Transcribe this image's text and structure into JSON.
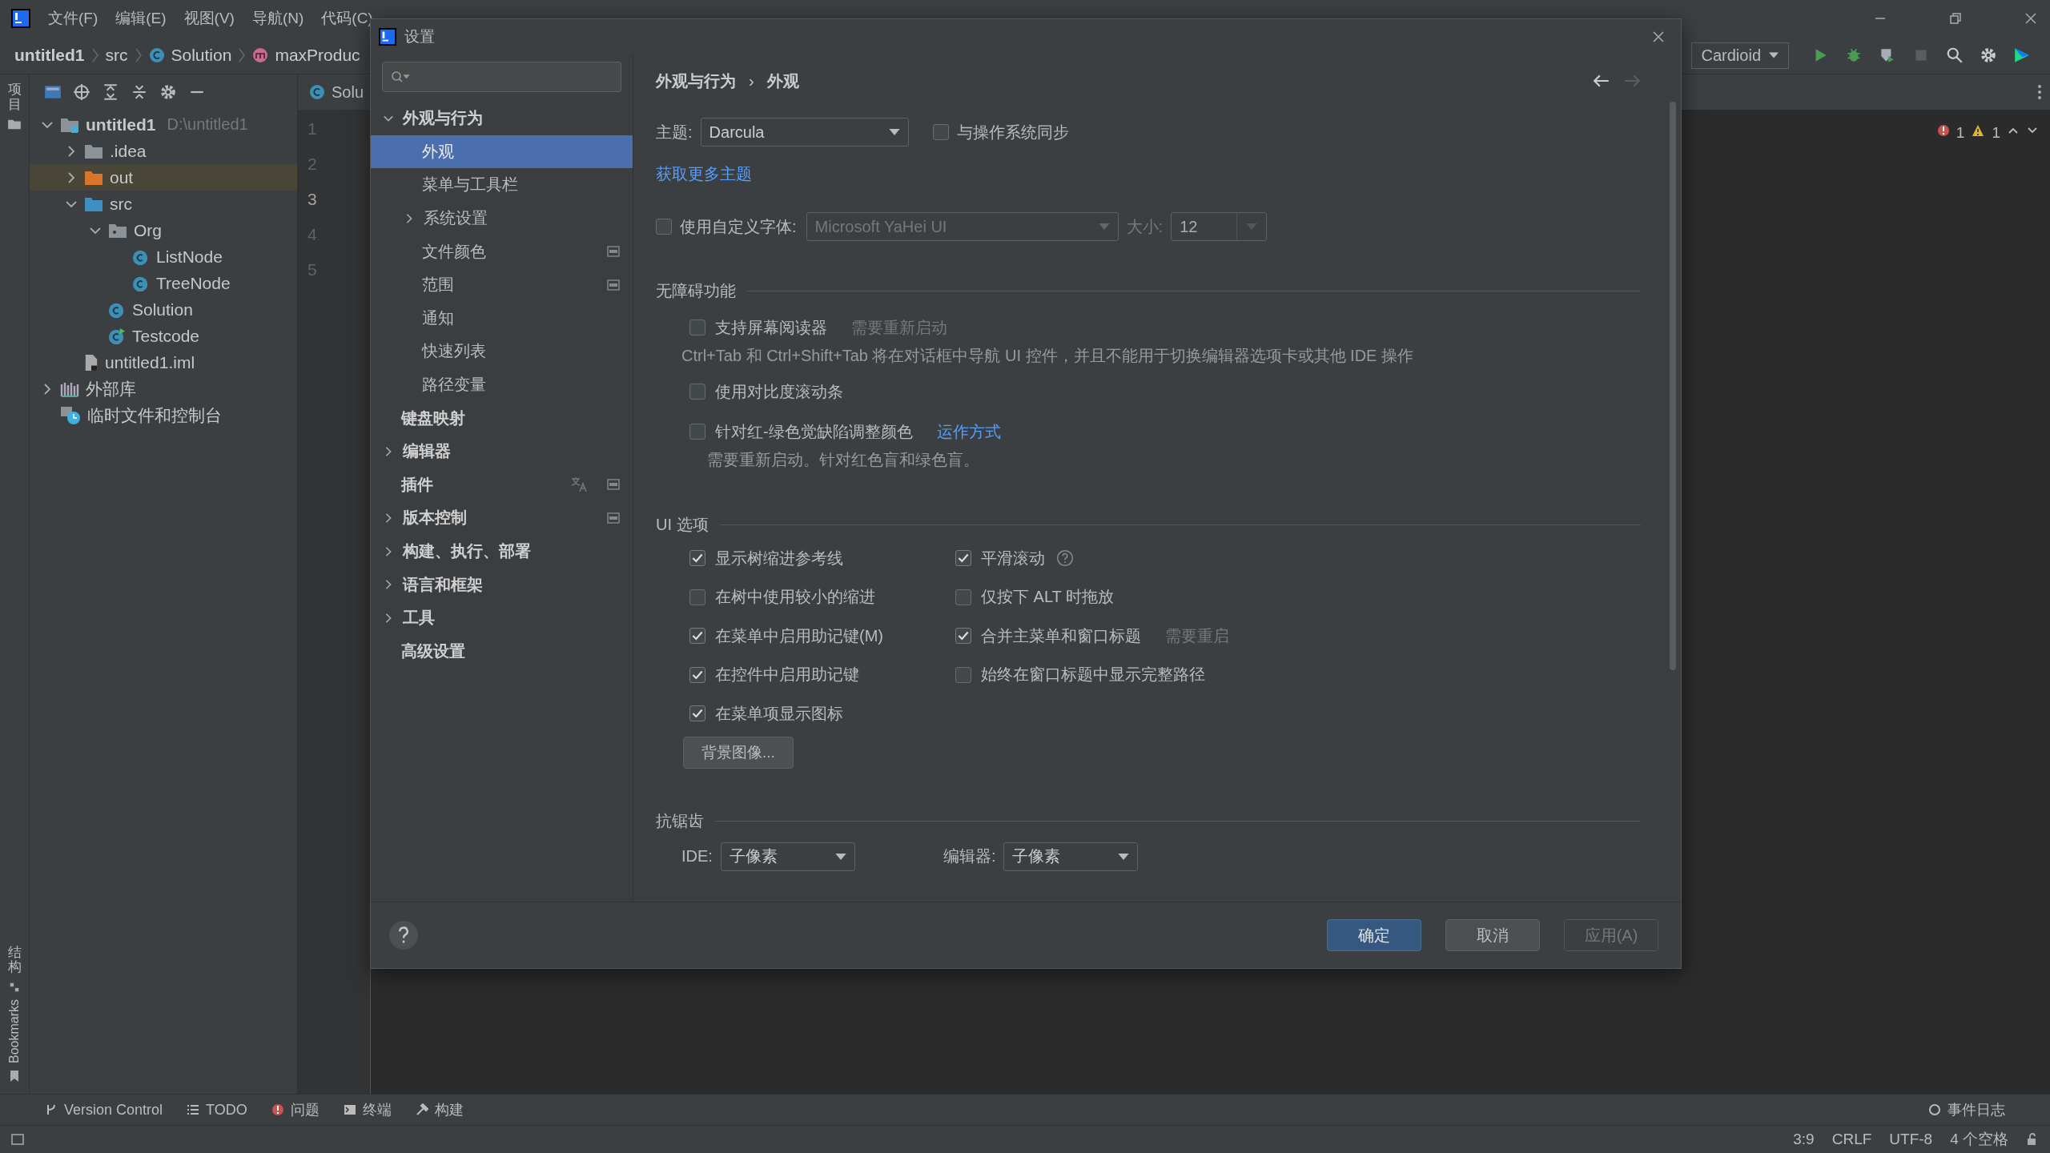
{
  "menu": [
    "文件(F)",
    "编辑(E)",
    "视图(V)",
    "导航(N)",
    "代码(C)"
  ],
  "breadcrumb": [
    {
      "label": "untitled1",
      "kind": "project"
    },
    {
      "label": "src",
      "kind": "folder"
    },
    {
      "label": "Solution",
      "kind": "class"
    },
    {
      "label": "maxProduc",
      "kind": "method"
    }
  ],
  "run_config": "Cardioid",
  "tool_strip": {
    "top": "项目",
    "bottom": [
      "结构",
      "Bookmarks"
    ]
  },
  "project_tree": [
    {
      "label": "untitled1",
      "note": "D:\\untitled1",
      "kind": "module",
      "expanded": true,
      "selected": false,
      "children": [
        {
          "label": ".idea",
          "kind": "folder",
          "expanded": false,
          "selected": false
        },
        {
          "label": "out",
          "kind": "excluded",
          "expanded": false,
          "selected": true
        },
        {
          "label": "src",
          "kind": "source",
          "expanded": true,
          "selected": false,
          "children": [
            {
              "label": "Org",
              "kind": "package",
              "expanded": true,
              "selected": false,
              "children": [
                {
                  "label": "ListNode",
                  "kind": "class",
                  "selected": false
                },
                {
                  "label": "TreeNode",
                  "kind": "class",
                  "selected": false
                }
              ]
            },
            {
              "label": "Solution",
              "kind": "class",
              "selected": false
            },
            {
              "label": "Testcode",
              "kind": "runnable",
              "selected": false
            }
          ]
        },
        {
          "label": "untitled1.iml",
          "kind": "file",
          "selected": false
        }
      ]
    },
    {
      "label": "外部库",
      "kind": "library",
      "expanded": false,
      "selected": false
    },
    {
      "label": "临时文件和控制台",
      "kind": "scratch",
      "selected": false
    }
  ],
  "editor": {
    "tab": "Solu",
    "line_numbers": [
      {
        "text": "1",
        "current": false
      },
      {
        "text": "2",
        "current": false
      },
      {
        "text": "3",
        "current": true
      },
      {
        "text": "4",
        "current": false
      },
      {
        "text": "5",
        "current": false
      }
    ],
    "errors": "1",
    "warnings": "1"
  },
  "dialog": {
    "title": "设置",
    "nav": [
      {
        "label": "外观与行为",
        "expanded": true,
        "selected": false,
        "children": [
          {
            "label": "外观",
            "selected": true
          },
          {
            "label": "菜单与工具栏",
            "selected": false
          },
          {
            "label": "系统设置",
            "expanded": false,
            "selected": false
          },
          {
            "label": "文件颜色",
            "selected": false,
            "project_level": true
          },
          {
            "label": "范围",
            "selected": false,
            "project_level": true
          },
          {
            "label": "通知",
            "selected": false
          },
          {
            "label": "快速列表",
            "selected": false
          },
          {
            "label": "路径变量",
            "selected": false
          }
        ]
      },
      {
        "label": "键盘映射",
        "selected": false
      },
      {
        "label": "编辑器",
        "expanded": false,
        "selected": false
      },
      {
        "label": "插件",
        "selected": false,
        "translated": true,
        "project_level": true
      },
      {
        "label": "版本控制",
        "expanded": false,
        "selected": false,
        "project_level": true
      },
      {
        "label": "构建、执行、部署",
        "expanded": false,
        "selected": false
      },
      {
        "label": "语言和框架",
        "expanded": false,
        "selected": false
      },
      {
        "label": "工具",
        "expanded": false,
        "selected": false
      },
      {
        "label": "高级设置",
        "selected": false
      }
    ],
    "breadcrumb": [
      "外观与行为",
      "›",
      "外观"
    ],
    "theme": {
      "label": "主题:",
      "value": "Darcula"
    },
    "sync": {
      "label": "与操作系统同步",
      "checked": false
    },
    "more_themes_link": "获取更多主题",
    "custom_font": {
      "label": "使用自定义字体:",
      "checked": false,
      "value": "Microsoft YaHei UI",
      "disabled": true,
      "size_label": "大小:",
      "size": "12"
    },
    "accessibility": {
      "title": "无障碍功能",
      "options": [
        {
          "label": "支持屏幕阅读器",
          "checked": false,
          "note": "需要重新启动",
          "description": "Ctrl+Tab 和 Ctrl+Shift+Tab 将在对话框中导航 UI 控件，并且不能用于切换编辑器选项卡或其他 IDE 操作"
        },
        {
          "label": "使用对比度滚动条",
          "checked": false
        },
        {
          "label": "针对红-绿色觉缺陷调整颜色",
          "checked": false,
          "link": "运作方式",
          "description": "需要重新启动。针对红色盲和绿色盲。"
        }
      ]
    },
    "ui_options": {
      "title": "UI 选项",
      "left": [
        {
          "label": "显示树缩进参考线",
          "checked": true
        },
        {
          "label": "在树中使用较小的缩进",
          "checked": false
        },
        {
          "label": "在菜单中启用助记键(M)",
          "checked": true
        },
        {
          "label": "在控件中启用助记键",
          "checked": true
        },
        {
          "label": "在菜单项显示图标",
          "checked": true
        }
      ],
      "right": [
        {
          "label": "平滑滚动",
          "checked": true,
          "help": true
        },
        {
          "label": "仅按下 ALT 时拖放",
          "checked": false
        },
        {
          "label": "合并主菜单和窗口标题",
          "checked": true,
          "note": "需要重启"
        },
        {
          "label": "始终在窗口标题中显示完整路径",
          "checked": false
        }
      ],
      "background_button": "背景图像..."
    },
    "antialiasing": {
      "title": "抗锯齿",
      "ide_label": "IDE:",
      "ide_value": "子像素",
      "editor_label": "编辑器:",
      "editor_value": "子像素"
    },
    "buttons": [
      {
        "label": "确定",
        "primary": true,
        "disabled": false
      },
      {
        "label": "取消",
        "primary": false,
        "disabled": false
      },
      {
        "label": "应用(A)",
        "primary": false,
        "disabled": true
      }
    ]
  },
  "bottom_tools": [
    {
      "label": "Version Control",
      "kind": "vcs"
    },
    {
      "label": "TODO",
      "kind": "todo"
    },
    {
      "label": "问题",
      "kind": "problems"
    },
    {
      "label": "终端",
      "kind": "terminal"
    },
    {
      "label": "构建",
      "kind": "build"
    }
  ],
  "event_log": "事件日志",
  "status": [
    "3:9",
    "CRLF",
    "UTF-8",
    "4 个空格"
  ]
}
